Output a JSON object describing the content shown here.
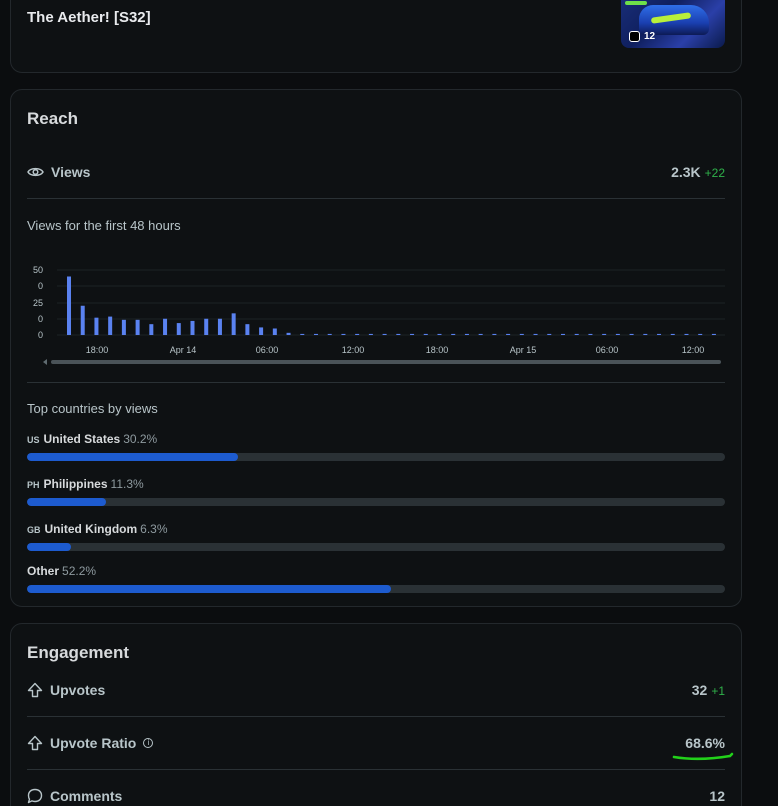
{
  "post": {
    "title": "The Aether! [S32]",
    "gallery_count": "12"
  },
  "reach": {
    "title": "Reach",
    "views_label": "Views",
    "views_value": "2.3K",
    "views_delta": "+22",
    "chart_title": "Views for the first 48 hours",
    "countries_title": "Top countries by views",
    "countries": [
      {
        "code": "US",
        "name": "United States",
        "pct": "30.2%",
        "fraction": 0.302
      },
      {
        "code": "PH",
        "name": "Philippines",
        "pct": "11.3%",
        "fraction": 0.113
      },
      {
        "code": "GB",
        "name": "United Kingdom",
        "pct": "6.3%",
        "fraction": 0.063
      },
      {
        "code": "",
        "name": "Other",
        "pct": "52.2%",
        "fraction": 0.522
      }
    ]
  },
  "chart_data": {
    "type": "bar",
    "title": "Views for the first 48 hours",
    "ytick_labels": [
      "50",
      "0",
      "25",
      "0",
      "0"
    ],
    "xtick_labels": [
      "18:00",
      "Apr 14",
      "06:00",
      "12:00",
      "18:00",
      "Apr 15",
      "06:00",
      "12:00"
    ],
    "values": [
      54,
      27,
      16,
      17,
      14,
      14,
      10,
      15,
      11,
      13,
      15,
      15,
      20,
      10,
      7,
      6,
      2,
      1,
      1,
      1,
      1,
      1,
      1,
      1,
      1,
      1,
      1,
      1,
      1,
      1,
      1,
      1,
      1,
      1,
      1,
      1,
      1,
      1,
      1,
      1,
      1,
      1,
      1,
      1,
      1,
      1,
      1,
      1
    ],
    "bar_color": "#5a82f0",
    "grid": true
  },
  "engagement": {
    "title": "Engagement",
    "upvotes_label": "Upvotes",
    "upvotes_value": "32",
    "upvotes_delta": "+1",
    "ratio_label": "Upvote Ratio",
    "ratio_value": "68.6%",
    "comments_label": "Comments",
    "comments_value": "12"
  },
  "colors": {
    "accent_bar": "#1d5bcf",
    "positive_delta": "#2fb24a",
    "annotation": "#22d11a"
  }
}
